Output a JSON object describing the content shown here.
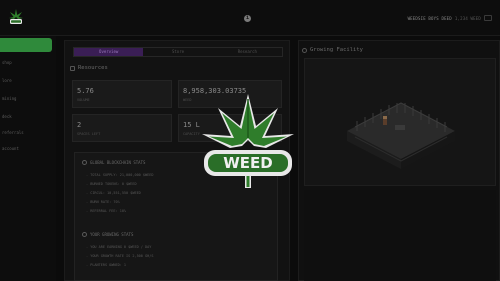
{
  "header": {
    "account": "WEEDSIE BOYS  DEED",
    "account_sub": "1,234 WEED",
    "info_icon": "info-icon"
  },
  "sidebar": {
    "items": [
      {
        "label": "",
        "active": true
      },
      {
        "label": "shop"
      },
      {
        "label": "lore"
      },
      {
        "label": "mining"
      },
      {
        "label": "deck"
      },
      {
        "label": "referrals"
      },
      {
        "label": "account"
      }
    ]
  },
  "tabs": [
    "Overview",
    "Store",
    "Research"
  ],
  "resources": {
    "title": "Resources",
    "cards": [
      {
        "value": "5.76",
        "label": "VOLUME"
      },
      {
        "value": "8,958,303.03735",
        "label": "WEED"
      },
      {
        "value": "2",
        "label": "SPACES LEFT"
      },
      {
        "value": "15 L",
        "label": "CAPACITY"
      }
    ]
  },
  "global_stats": {
    "title": "GLOBAL BLOCKCHAIN STATS",
    "lines": [
      "- TOTAL SUPPLY: 21,000,000 $WEED",
      "- BURNED TOKENS: 0 $WEED",
      "- CIRCUL: 10,551,550 $WEED",
      "- BURN RATE: 70%",
      "- REFERRAL FEE: 10%"
    ]
  },
  "your_stats": {
    "title": "YOUR GROWING STATS",
    "lines": [
      "- YOU ARE EARNING 0 $WEED / DAY",
      "- YOUR GROWTH RATE IS 2,500 GH/S",
      "- PLANTERS OWNED: 1"
    ]
  },
  "facility": {
    "title": "Growing Facility"
  },
  "overlay": {
    "logo_text": "WEED"
  },
  "colors": {
    "accent_green": "#2f8a3b",
    "tab_purple": "#3a1e55",
    "leaf_green": "#2f7d2b",
    "leaf_dark": "#1d5a1b"
  }
}
